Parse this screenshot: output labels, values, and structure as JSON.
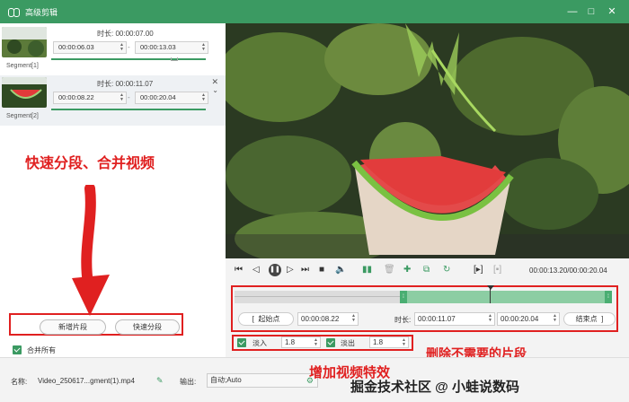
{
  "window": {
    "title": "高级剪辑",
    "min": "—",
    "max": "□",
    "close": "✕"
  },
  "segments": [
    {
      "label": "Segment[1]",
      "duration_label": "时长:",
      "duration": "00:00:07.00",
      "start": "00:00:06.03",
      "end": "00:00:13.03"
    },
    {
      "label": "Segment[2]",
      "duration_label": "时长:",
      "duration": "00:00:11.07",
      "start": "00:00:08.22",
      "end": "00:00:20.04"
    }
  ],
  "annotations": {
    "top": "快速分段、合并视频",
    "right": "删除不需要的片段",
    "bottom": "增加视频特效"
  },
  "left_buttons": {
    "add_segment": "新增片段",
    "quick_split": "快速分段",
    "merge_all": "合并所有"
  },
  "player": {
    "time": "00:00:13.20/00:00:20.04"
  },
  "trim": {
    "start_btn": "起始点",
    "start_val": "00:00:08.22",
    "duration_label": "时长:",
    "duration_val": "00:00:11.07",
    "end_val": "00:00:20.04",
    "end_btn": "结束点"
  },
  "effects": {
    "fade_in_label": "淡入",
    "fade_in": "1.8",
    "fade_out_label": "淡出",
    "fade_out": "1.8"
  },
  "footer": {
    "name_label": "名称:",
    "name_value": "Video_250617...gment(1).mp4",
    "output_label": "输出:",
    "output_value": "自动;Auto"
  },
  "watermark": "掘金技术社区 @ 小蛙说数码",
  "colors": {
    "accent": "#3b9a62",
    "annotation": "#e02020"
  }
}
